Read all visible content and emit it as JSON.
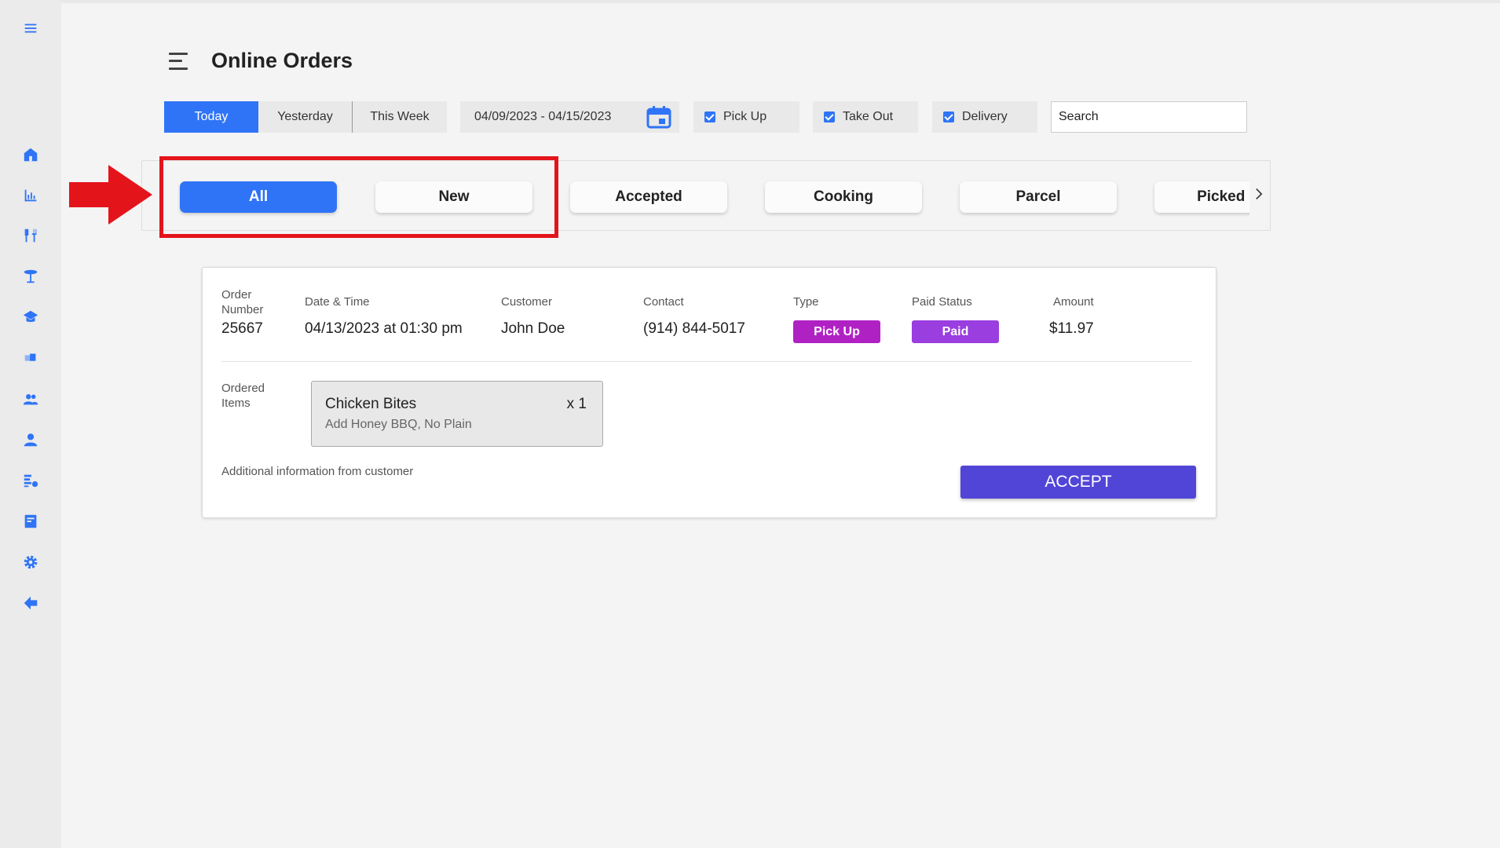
{
  "sidebar": {
    "items": [
      {
        "icon": "home-icon"
      },
      {
        "icon": "bar-chart-icon"
      },
      {
        "icon": "utensils-icon"
      },
      {
        "icon": "table-icon"
      },
      {
        "icon": "chef-hat-icon"
      },
      {
        "icon": "tickets-icon"
      },
      {
        "icon": "users-icon"
      },
      {
        "icon": "user-icon"
      },
      {
        "icon": "list-icon"
      },
      {
        "icon": "document-icon"
      },
      {
        "icon": "gear-icon"
      },
      {
        "icon": "logout-arrow-icon"
      }
    ],
    "accent": "#2f74f6"
  },
  "header": {
    "title": "Online Orders"
  },
  "filters": {
    "range": [
      {
        "label": "Today",
        "active": true
      },
      {
        "label": "Yesterday",
        "active": false
      },
      {
        "label": "This Week",
        "active": false
      }
    ],
    "date_range": "04/09/2023 - 04/15/2023",
    "types": [
      {
        "label": "Pick Up",
        "checked": true
      },
      {
        "label": "Take Out",
        "checked": true
      },
      {
        "label": "Delivery",
        "checked": true
      }
    ],
    "search_placeholder": "Search"
  },
  "status_tabs": [
    {
      "label": "All",
      "active": true
    },
    {
      "label": "New",
      "active": false
    },
    {
      "label": "Accepted",
      "active": false
    },
    {
      "label": "Cooking",
      "active": false
    },
    {
      "label": "Parcel",
      "active": false
    },
    {
      "label": "Picked Up",
      "active": false
    }
  ],
  "order": {
    "labels": {
      "order_number": "Order Number",
      "date_time": "Date & Time",
      "customer": "Customer",
      "contact": "Contact",
      "type": "Type",
      "paid_status": "Paid Status",
      "amount": "Amount",
      "ordered_items": "Ordered Items",
      "additional_info": "Additional information from customer"
    },
    "order_number": "25667",
    "date_time": "04/13/2023 at 01:30 pm",
    "customer": "John Doe",
    "contact": "(914) 844-5017",
    "type": "Pick Up",
    "type_color": "#b021c4",
    "paid_status": "Paid",
    "paid_color": "#9a3ee0",
    "amount": "$11.97",
    "items": [
      {
        "name": "Chicken Bites",
        "qty": "x 1",
        "mods": "Add Honey BBQ, No Plain"
      }
    ],
    "accept_label": "ACCEPT",
    "accept_color": "#5145d8"
  },
  "annotation": {
    "highlight_color": "#e4141b"
  }
}
